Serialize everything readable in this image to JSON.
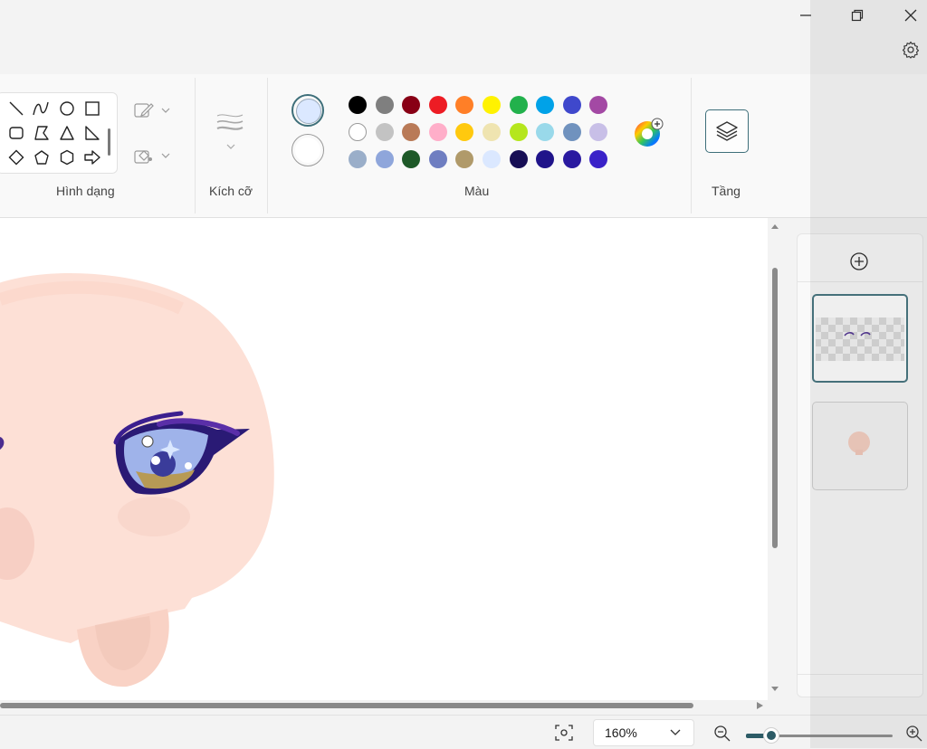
{
  "window": {
    "controls": [
      {
        "name": "minimize-button",
        "icon": "minimize-icon"
      },
      {
        "name": "restore-button",
        "icon": "restore-icon"
      },
      {
        "name": "close-button",
        "icon": "close-icon"
      }
    ],
    "settings_icon": "gear-icon"
  },
  "ribbon": {
    "shapes": {
      "label": "Hình dạng",
      "items": [
        "line",
        "curve",
        "oval",
        "rectangle",
        "rounded-rectangle",
        "polygon",
        "triangle",
        "right-triangle",
        "diamond",
        "pentagon",
        "hexagon",
        "right-arrow"
      ],
      "outline_icon": "outline-pen-icon",
      "fill_icon": "fill-bucket-icon"
    },
    "size": {
      "label": "Kích cỡ",
      "icon": "brush-size-icon"
    },
    "colors": {
      "label": "Màu",
      "color1": "#dbe8ff",
      "color2": "#ffffff",
      "palette": [
        [
          "#000000",
          "#7f7f7f",
          "#880015",
          "#ed1c24",
          "#ff7f27",
          "#fff200",
          "#22b14c",
          "#00a2e8",
          "#3f48cc",
          "#a349a4"
        ],
        [
          "#ffffff",
          "#c3c3c3",
          "#b97a57",
          "#ffaec9",
          "#ffc90e",
          "#efe4b0",
          "#b5e61d",
          "#99d9ea",
          "#7092be",
          "#c8bfe7"
        ],
        [
          "#9aaec9",
          "#8fa6db",
          "#1e5928",
          "#6f7ec1",
          "#b09a6a",
          "#dbe8ff",
          "#170e55",
          "#20148a",
          "#2a1aa0",
          "#3a22c8"
        ]
      ],
      "edit_icon": "color-wheel-icon"
    },
    "layers": {
      "label": "Tầng",
      "icon": "layers-icon"
    }
  },
  "layers_panel": {
    "add_icon": "add-layer-icon",
    "layers": [
      {
        "name": "layer-1",
        "selected": true
      },
      {
        "name": "layer-2",
        "selected": false
      }
    ]
  },
  "status": {
    "fit_icon": "fit-to-window-icon",
    "zoom": "160%",
    "zoom_out_icon": "zoom-out-icon",
    "zoom_in_icon": "zoom-in-icon",
    "zoom_slider_fraction": 0.17
  }
}
